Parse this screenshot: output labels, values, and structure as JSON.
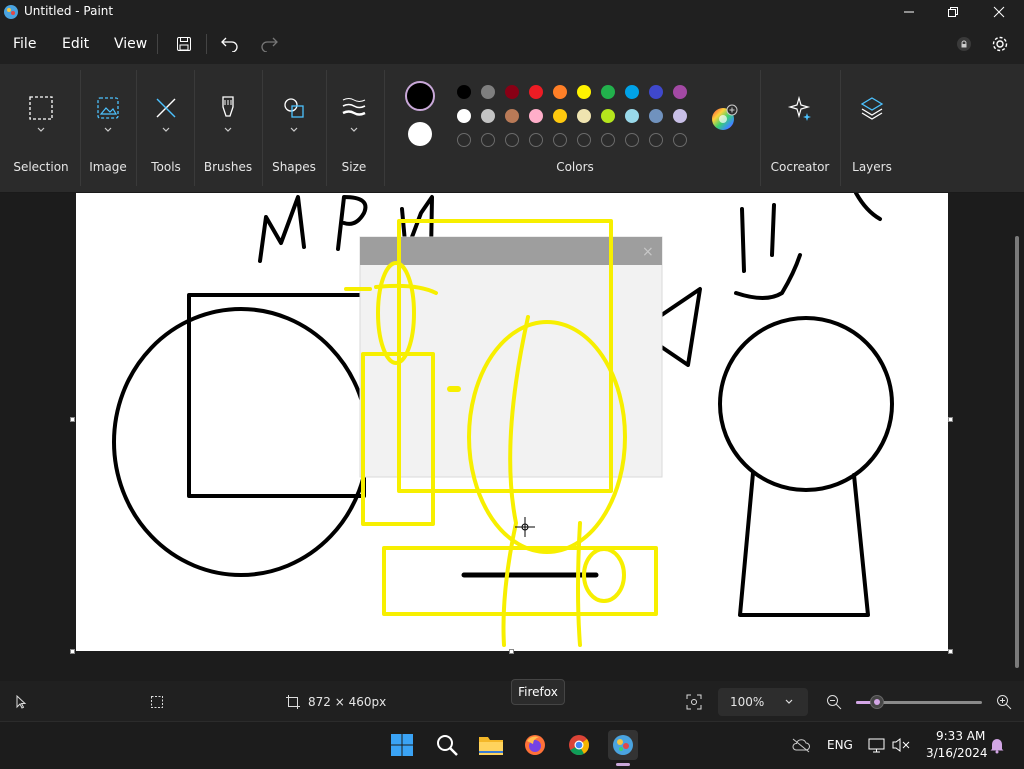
{
  "window": {
    "title": "Untitled - Paint"
  },
  "menu": {
    "file": "File",
    "edit": "Edit",
    "view": "View"
  },
  "ribbon": {
    "groups": {
      "selection": "Selection",
      "image": "Image",
      "tools": "Tools",
      "brushes": "Brushes",
      "shapes": "Shapes",
      "size": "Size",
      "colors": "Colors",
      "cocreator": "Cocreator",
      "layers": "Layers"
    },
    "primary_color": "#000000",
    "secondary_color": "#ffffff",
    "palette_row1": [
      "#000000",
      "#7f7f7f",
      "#880015",
      "#ed1c24",
      "#ff7f27",
      "#fff200",
      "#22b14c",
      "#00a2e8",
      "#3f48cc",
      "#a349a4"
    ],
    "palette_row2": [
      "#ffffff",
      "#c3c3c3",
      "#b97a57",
      "#ffaec9",
      "#ffc90e",
      "#efe4b0",
      "#b5e61d",
      "#99d9ea",
      "#7092be",
      "#c8bfe7"
    ]
  },
  "status": {
    "canvas_size": "872 × 460px",
    "zoom": "100%",
    "zoom_level_fraction": 0.17
  },
  "tooltip": {
    "text": "Firefox"
  },
  "tray": {
    "language": "ENG",
    "time": "9:33 AM",
    "date": "3/16/2024"
  }
}
